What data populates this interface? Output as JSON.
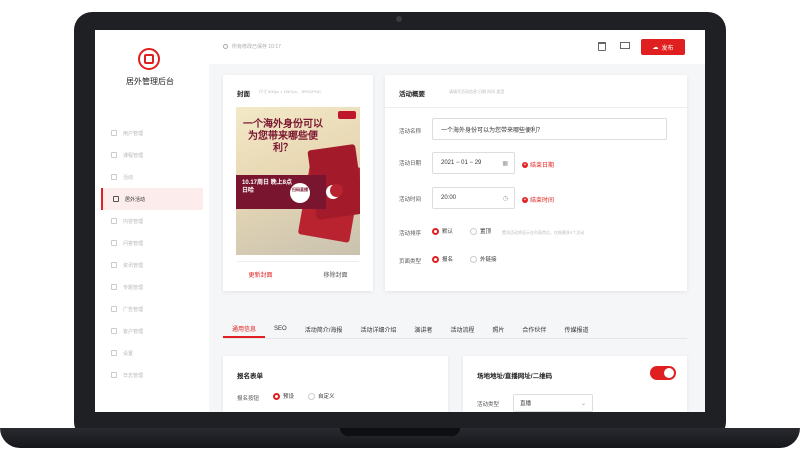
{
  "app": {
    "title": "居外管理后台"
  },
  "sidebar": {
    "items": [
      {
        "label": "用户管理"
      },
      {
        "label": "课程管理"
      },
      {
        "label": "活动"
      },
      {
        "label": "居外活动"
      },
      {
        "label": "内容管理"
      },
      {
        "label": "问答管理"
      },
      {
        "label": "资讯管理"
      },
      {
        "label": "专题管理"
      },
      {
        "label": "广告管理"
      },
      {
        "label": "客户管理"
      },
      {
        "label": "设置"
      },
      {
        "label": "日志管理"
      }
    ],
    "active_index": 3
  },
  "topbar": {
    "save_status": "所有修改已保存 10:17",
    "publish_label": "发布"
  },
  "cover": {
    "title": "封面",
    "hint": "尺寸 800px × 1067px，JPEG/PNG",
    "poster_headline": "一个海外身份可以为您带来哪些便利？",
    "poster_date": "10.17周日 晚上8点 日哈",
    "poster_badge": "扫码直播",
    "change_label": "更新封面",
    "remove_label": "移除封面"
  },
  "overview": {
    "title": "活动概要",
    "hint": "请填写活动信息  日期  时间  类型",
    "name_label": "活动名称",
    "name_value": "一个海外身份可以为您带来哪些便利？",
    "date_label": "活动日期",
    "date_value": "2021 − 01 − 29",
    "end_date_label": "结束日期",
    "time_label": "活动时间",
    "time_value": "20:00",
    "end_time_label": "结束时间",
    "order_label": "活动排序",
    "order_options": [
      "默认",
      "置顶"
    ],
    "order_selected": "默认",
    "order_hint": "置顶活动将显示在列表首位，仅限最多3个活动",
    "page_type_label": "页面类型",
    "page_type_options": [
      "报名",
      "外链接"
    ],
    "page_type_selected": "报名"
  },
  "tabs": {
    "items": [
      "通用信息",
      "SEO",
      "活动简介/海报",
      "活动详细介绍",
      "演讲者",
      "活动流程",
      "照片",
      "合作伙伴",
      "传媒报道"
    ],
    "active_index": 0
  },
  "registration": {
    "title": "报名表单",
    "button_label": "报名按钮",
    "options": [
      "预设",
      "自定义"
    ],
    "selected": "预设"
  },
  "location": {
    "title": "场地地址/直播网址/二维码",
    "toggle_on": true,
    "type_label": "活动类型",
    "type_value": "直播"
  },
  "colors": {
    "accent": "#e02020",
    "poster": "#7a1530"
  }
}
